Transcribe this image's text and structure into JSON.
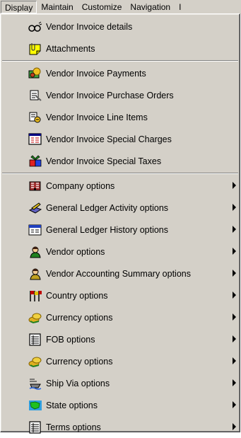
{
  "menubar": {
    "items": [
      {
        "label": "Display"
      },
      {
        "label": "Maintain"
      },
      {
        "label": "Customize"
      },
      {
        "label": "Navigation"
      },
      {
        "label": "I"
      }
    ]
  },
  "menu": {
    "group1": [
      {
        "label": "Vendor Invoice details",
        "icon": "binoculars-icon"
      },
      {
        "label": "Attachments",
        "icon": "paperclip-note-icon"
      }
    ],
    "group2": [
      {
        "label": "Vendor Invoice Payments",
        "icon": "payments-icon"
      },
      {
        "label": "Vendor Invoice Purchase Orders",
        "icon": "purchase-orders-icon"
      },
      {
        "label": "Vendor Invoice Line Items",
        "icon": "line-items-icon"
      },
      {
        "label": "Vendor Invoice Special Charges",
        "icon": "special-charges-icon"
      },
      {
        "label": "Vendor Invoice Special Taxes",
        "icon": "special-taxes-icon"
      }
    ],
    "group3": [
      {
        "label": "Company options",
        "icon": "company-icon"
      },
      {
        "label": "General Ledger Activity options",
        "icon": "ledger-activity-icon"
      },
      {
        "label": "General Ledger History options",
        "icon": "ledger-history-icon"
      },
      {
        "label": "Vendor options",
        "icon": "vendor-person-icon"
      },
      {
        "label": "Vendor Accounting Summary options",
        "icon": "vendor-summary-icon"
      },
      {
        "label": "Country options",
        "icon": "country-flags-icon"
      },
      {
        "label": "Currency options",
        "icon": "currency-coins-icon"
      },
      {
        "label": "FOB options",
        "icon": "fob-list-icon"
      },
      {
        "label": "Currency options",
        "icon": "currency-coins-icon"
      },
      {
        "label": "Ship Via options",
        "icon": "ship-via-icon"
      },
      {
        "label": "State options",
        "icon": "state-map-icon"
      },
      {
        "label": "Terms options",
        "icon": "terms-list-icon"
      }
    ]
  },
  "colors": {
    "menu_face": "#d4d0c8",
    "shadow": "#808080",
    "highlight": "#ffffff"
  }
}
